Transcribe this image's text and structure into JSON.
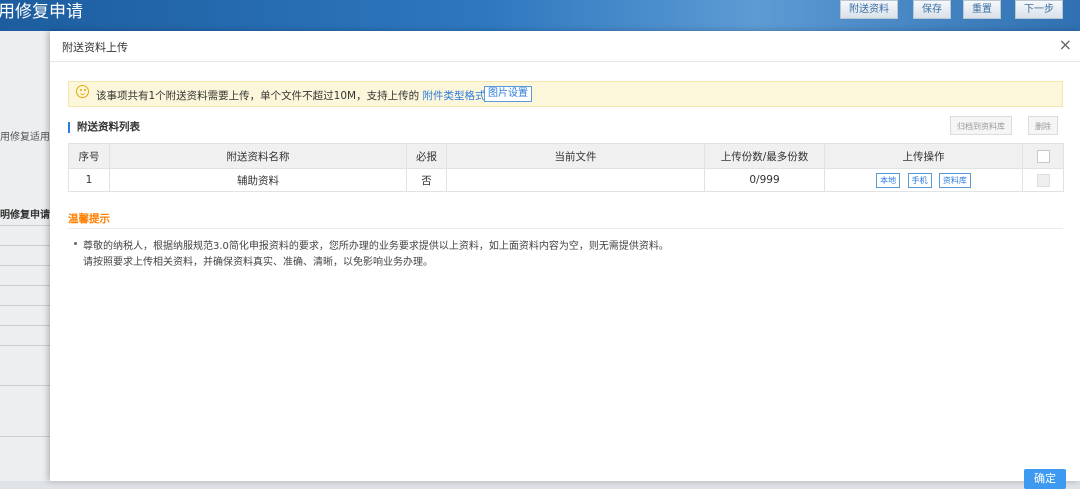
{
  "background": {
    "title": "用修复申请",
    "buttons": [
      "附送资料",
      "保存",
      "重置",
      "下一步"
    ],
    "side_texts": [
      "用修复适用",
      "明修复申请表"
    ]
  },
  "modal": {
    "title": "附送资料上传",
    "close": "×",
    "notice": {
      "text": "该事项共有1个附送资料需要上传，单个文件不超过10M，支持上传的",
      "link": "附件类型格式",
      "button": "图片设置"
    },
    "list_title": "附送资料列表",
    "toolbar": {
      "archive": "归档到资料库",
      "delete": "删除"
    },
    "table": {
      "headers": [
        "序号",
        "附送资料名称",
        "必报",
        "当前文件",
        "上传份数/最多份数",
        "上传操作"
      ],
      "rows": [
        {
          "index": "1",
          "name": "辅助资料",
          "required": "否",
          "file": "",
          "count": "0/999",
          "ops": [
            "本地",
            "手机",
            "资料库"
          ]
        }
      ]
    },
    "tips": {
      "title": "温馨提示",
      "line1": "尊敬的纳税人，根据纳服规范3.0简化申报资料的要求，您所办理的业务要求提供以上资料，如上面资料内容为空，则无需提供资料。",
      "line2": "请按照要求上传相关资料，并确保资料真实、准确、清晰，以免影响业务办理。"
    },
    "confirm": "确定"
  }
}
